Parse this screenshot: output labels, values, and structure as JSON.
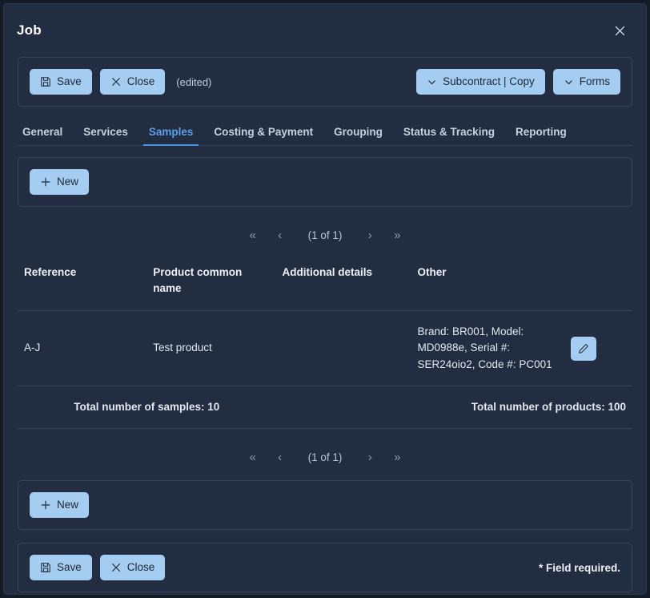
{
  "window": {
    "title": "Job",
    "close_icon": "close-icon"
  },
  "toolbar": {
    "save_label": "Save",
    "close_label": "Close",
    "edited_note": "(edited)",
    "subcontract_copy_label": "Subcontract | Copy",
    "forms_label": "Forms"
  },
  "tabs": [
    {
      "label": "General",
      "active": false
    },
    {
      "label": "Services",
      "active": false
    },
    {
      "label": "Samples",
      "active": true
    },
    {
      "label": "Costing & Payment",
      "active": false
    },
    {
      "label": "Grouping",
      "active": false
    },
    {
      "label": "Status & Tracking",
      "active": false
    },
    {
      "label": "Reporting",
      "active": false
    }
  ],
  "new_top": {
    "label": "New"
  },
  "new_bottom": {
    "label": "New"
  },
  "pager_top": {
    "first": "«",
    "prev": "‹",
    "label": "(1 of 1)",
    "next": "›",
    "last": "»"
  },
  "pager_bottom": {
    "first": "«",
    "prev": "‹",
    "label": "(1 of 1)",
    "next": "›",
    "last": "»"
  },
  "table": {
    "columns": [
      "Reference",
      "Product common name",
      "Additional details",
      "Other",
      ""
    ],
    "rows": [
      {
        "reference": "A-J",
        "product_common_name": "Test product",
        "additional_details": "",
        "other": "Brand: BR001, Model: MD0988e, Serial #: SER24oio2, Code #: PC001",
        "edit_icon": "pencil-icon"
      }
    ],
    "totals": {
      "samples": "Total number of samples: 10",
      "products": "Total number of products: 100"
    }
  },
  "footer": {
    "save_label": "Save",
    "close_label": "Close",
    "field_required": "* Field required."
  },
  "colors": {
    "dialog_bg": "#222d42",
    "page_bg": "#141b27",
    "accent_button": "#a5cdf2",
    "active_tab": "#5c9fe8",
    "border": "#36445c"
  }
}
